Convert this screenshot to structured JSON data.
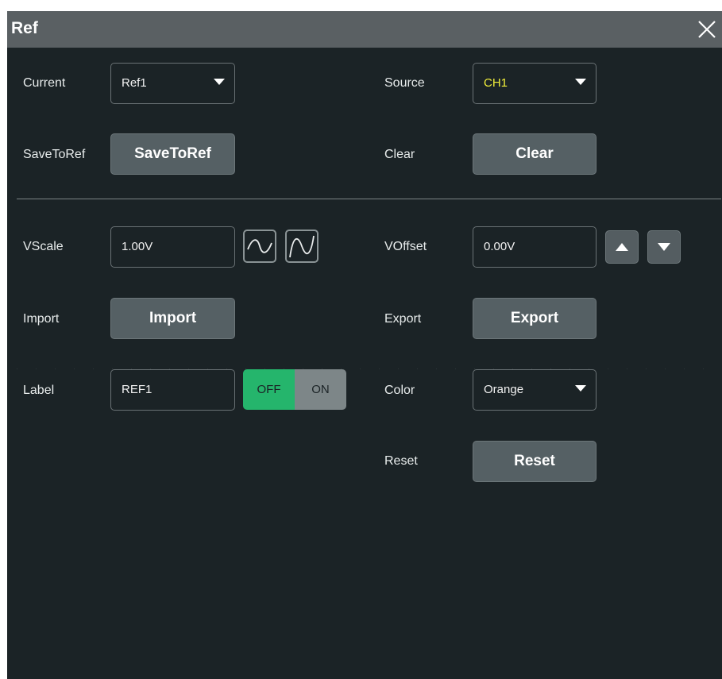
{
  "window": {
    "title": "Ref"
  },
  "rows": {
    "current": {
      "label": "Current",
      "value": "Ref1"
    },
    "source": {
      "label": "Source",
      "value": "CH1",
      "value_color": "#f2ef3a"
    },
    "save_to_ref": {
      "label": "SaveToRef",
      "button": "SaveToRef"
    },
    "clear": {
      "label": "Clear",
      "button": "Clear"
    },
    "vscale": {
      "label": "VScale",
      "value": "1.00V"
    },
    "voffset": {
      "label": "VOffset",
      "value": "0.00V"
    },
    "import": {
      "label": "Import",
      "button": "Import"
    },
    "export": {
      "label": "Export",
      "button": "Export"
    },
    "label": {
      "label": "Label",
      "value": "REF1",
      "toggle_off": "OFF",
      "toggle_on": "ON",
      "state": "OFF"
    },
    "color": {
      "label": "Color",
      "value": "Orange"
    },
    "reset": {
      "label": "Reset",
      "button": "Reset"
    }
  },
  "icons": {
    "close": "close-icon",
    "vscale_fine": "sine-wave-icon",
    "vscale_coarse": "sine-wave-icon",
    "voffset_up": "triangle-up-icon",
    "voffset_down": "triangle-down-icon",
    "dropdown": "chevron-down-icon"
  },
  "colors": {
    "background": "#1b2326",
    "titlebar": "#5a6063",
    "button": "#556064",
    "toggle_active": "#25b56c",
    "toggle_inactive": "#7d8688"
  }
}
